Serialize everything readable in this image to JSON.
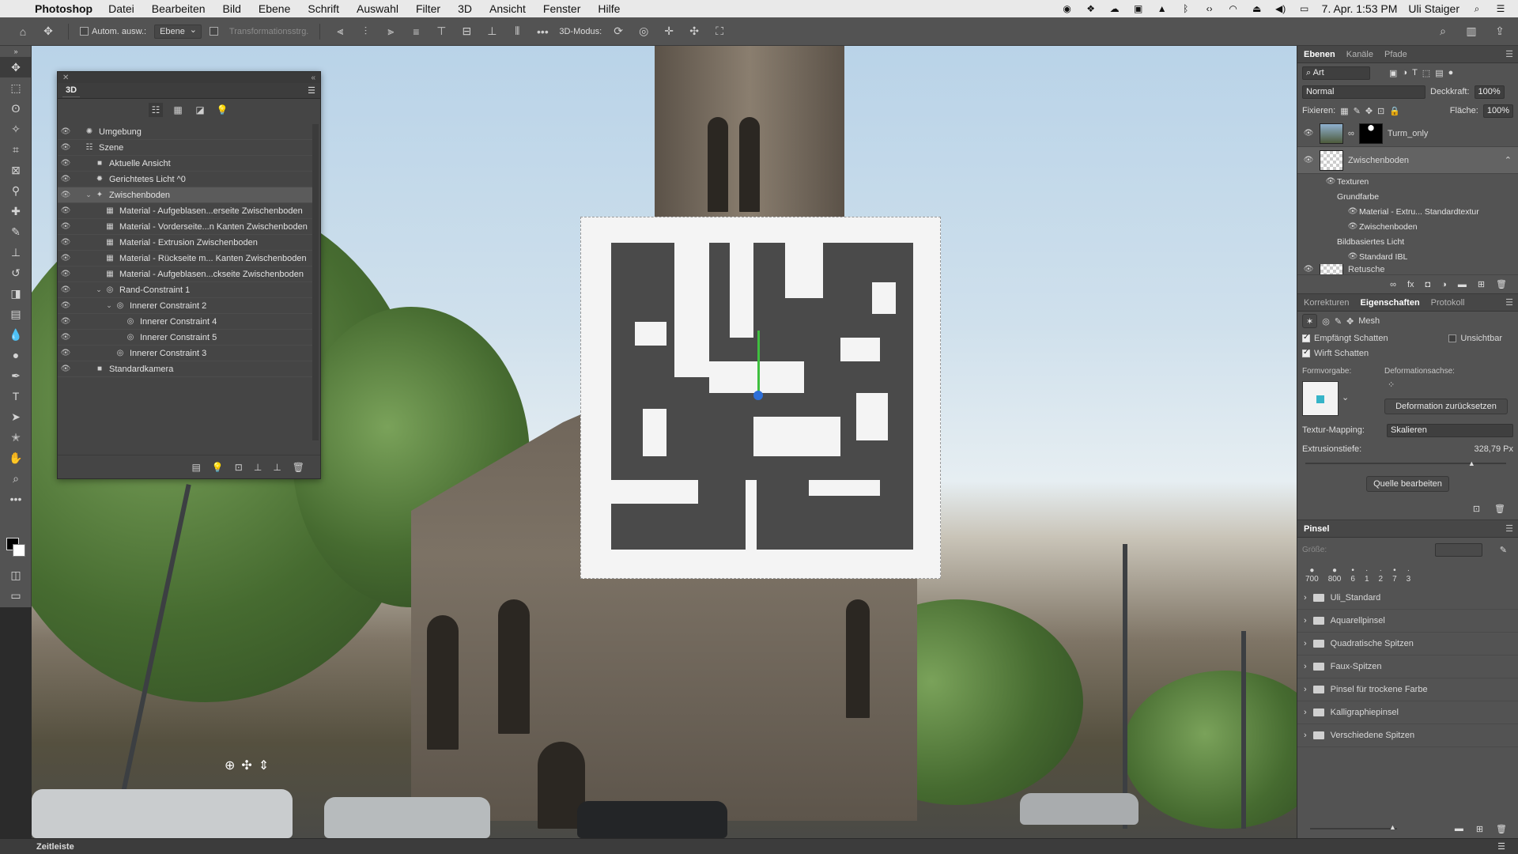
{
  "menubar": {
    "app_name": "Photoshop",
    "items": [
      "Datei",
      "Bearbeiten",
      "Bild",
      "Ebene",
      "Schrift",
      "Auswahl",
      "Filter",
      "3D",
      "Ansicht",
      "Fenster",
      "Hilfe"
    ],
    "clock": "7. Apr. 1:53 PM",
    "user": "Uli Staiger"
  },
  "options": {
    "auto_select_label": "Autom. ausw.:",
    "auto_select_value": "Ebene",
    "transform_label": "Transformationsstrg.",
    "mode_label": "3D-Modus:"
  },
  "panel3d": {
    "tab": "3D",
    "rows": [
      {
        "label": "Umgebung",
        "indent": 0,
        "icon": "environment-icon"
      },
      {
        "label": "Szene",
        "indent": 0,
        "icon": "scene-icon"
      },
      {
        "label": "Aktuelle Ansicht",
        "indent": 1,
        "icon": "camera-icon"
      },
      {
        "label": "Gerichtetes Licht ^0",
        "indent": 1,
        "icon": "light-icon"
      },
      {
        "label": "Zwischenboden",
        "indent": 1,
        "icon": "mesh-icon",
        "selected": true,
        "expanded": true
      },
      {
        "label": "Material - Aufgeblasen...erseite Zwischenboden",
        "indent": 2,
        "icon": "material-icon"
      },
      {
        "label": "Material - Vorderseite...n Kanten Zwischenboden",
        "indent": 2,
        "icon": "material-icon"
      },
      {
        "label": "Material - Extrusion Zwischenboden",
        "indent": 2,
        "icon": "material-icon"
      },
      {
        "label": "Material - Rückseite m... Kanten Zwischenboden",
        "indent": 2,
        "icon": "material-icon"
      },
      {
        "label": "Material - Aufgeblasen...ckseite Zwischenboden",
        "indent": 2,
        "icon": "material-icon"
      },
      {
        "label": "Rand-Constraint 1",
        "indent": 2,
        "icon": "constraint-icon",
        "expanded": true
      },
      {
        "label": "Innerer Constraint 2",
        "indent": 3,
        "icon": "constraint-icon",
        "expanded": true
      },
      {
        "label": "Innerer Constraint 4",
        "indent": 4,
        "icon": "constraint-icon"
      },
      {
        "label": "Innerer Constraint 5",
        "indent": 4,
        "icon": "constraint-icon"
      },
      {
        "label": "Innerer Constraint 3",
        "indent": 3,
        "icon": "constraint-icon"
      },
      {
        "label": "Standardkamera",
        "indent": 1,
        "icon": "camera-icon"
      }
    ]
  },
  "layers": {
    "tabs": [
      "Ebenen",
      "Kanäle",
      "Pfade"
    ],
    "active_tab": "Ebenen",
    "filter_value": "Art",
    "blend_mode": "Normal",
    "opacity_label": "Deckkraft:",
    "opacity_value": "100%",
    "lock_label": "Fixieren:",
    "fill_label": "Fläche:",
    "fill_value": "100%",
    "items": [
      {
        "name": "Turm_only"
      },
      {
        "name": "Zwischenboden",
        "selected": true
      }
    ],
    "sub_items": [
      "Texturen",
      "Grundfarbe",
      "Material - Extru... Standardtextur",
      "Zwischenboden",
      "Bildbasiertes Licht",
      "Standard IBL"
    ],
    "partial_layer": "Retusche"
  },
  "properties": {
    "tabs": [
      "Korrekturen",
      "Eigenschaften",
      "Protokoll"
    ],
    "active_tab": "Eigenschaften",
    "mode_label": "Mesh",
    "receives_shadow": "Empfängt Schatten",
    "invisible": "Unsichtbar",
    "casts_shadow": "Wirft Schatten",
    "shape_preset_label": "Formvorgabe:",
    "deform_axis_label": "Deformationsachse:",
    "reset_deform": "Deformation zurücksetzen",
    "texture_mapping_label": "Textur-Mapping:",
    "texture_mapping_value": "Skalieren",
    "extrusion_label": "Extrusionstiefe:",
    "extrusion_value": "328,79 Px",
    "extrusion_fraction": 0.83,
    "edit_source": "Quelle bearbeiten"
  },
  "brushes": {
    "title": "Pinsel",
    "size_label": "Größe:",
    "presets": [
      "700",
      "800",
      "6",
      "1",
      "2",
      "7",
      "3"
    ],
    "folders": [
      "Uli_Standard",
      "Aquarellpinsel",
      "Quadratische Spitzen",
      "Faux-Spitzen",
      "Pinsel für trockene Farbe",
      "Kalligraphiepinsel",
      "Verschiedene Spitzen"
    ]
  },
  "statusbar": {
    "timeline": "Zeitleiste"
  }
}
